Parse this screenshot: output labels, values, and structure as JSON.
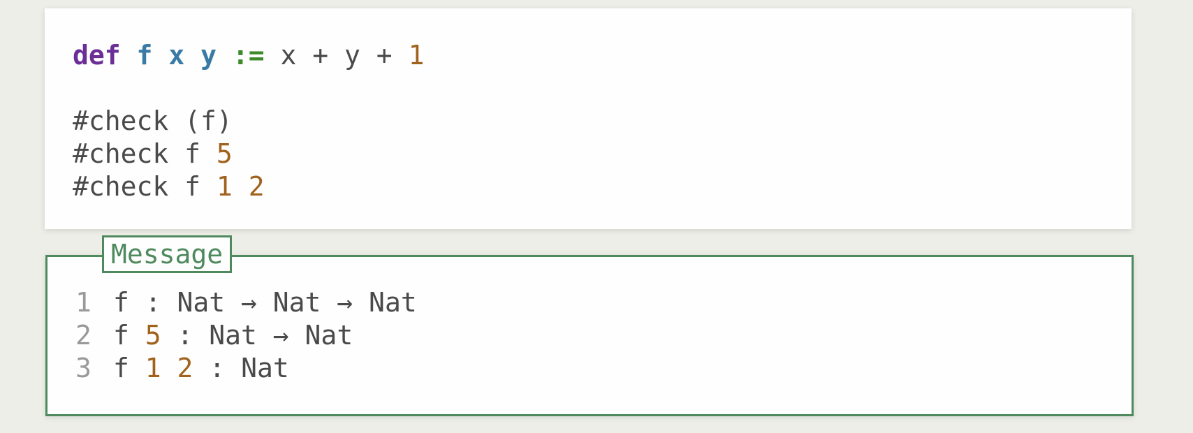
{
  "editor": {
    "def_line": {
      "kw": "def",
      "name": "f",
      "arg1": "x",
      "arg2": "y",
      "assign": ":=",
      "body_pre": "x + y + ",
      "body_num": "1"
    },
    "check_lines": [
      {
        "text": "#check (f)"
      },
      {
        "prefix": "#check f ",
        "n1": "5"
      },
      {
        "prefix": "#check f ",
        "n1": "1",
        "n2": "2"
      }
    ]
  },
  "message": {
    "label": "Message",
    "lines": [
      {
        "num": "1",
        "expr": "f",
        "type": " : Nat → Nat → Nat"
      },
      {
        "num": "2",
        "expr": "f ",
        "arg1": "5",
        "type": " : Nat → Nat"
      },
      {
        "num": "3",
        "expr": "f ",
        "arg1": "1",
        "arg2": "2",
        "type": " : Nat"
      }
    ]
  },
  "colors": {
    "keyword": "#6b2d96",
    "identifier": "#3a7ba6",
    "operator": "#3d8a2a",
    "number": "#a0621c",
    "text": "#4a4a4a",
    "message_border": "#4e8a5e",
    "line_number": "#999999",
    "background": "#eeeee8"
  }
}
